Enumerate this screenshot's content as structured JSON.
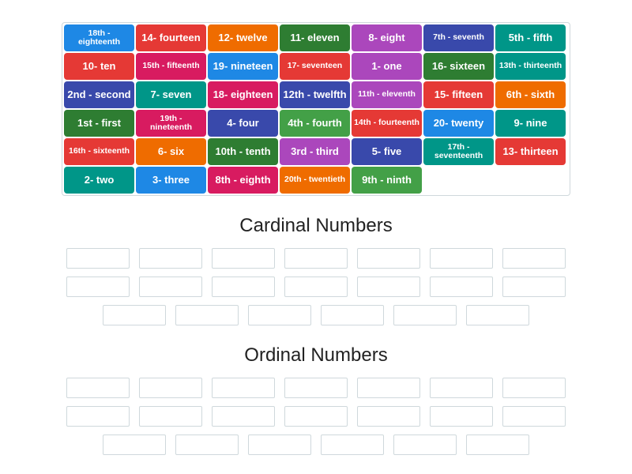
{
  "tiles": [
    {
      "label": "18th - eighteenth",
      "color": "c-blue",
      "small": true
    },
    {
      "label": "14- fourteen",
      "color": "c-red",
      "small": false
    },
    {
      "label": "12- twelve",
      "color": "c-orange",
      "small": false
    },
    {
      "label": "11- eleven",
      "color": "c-green",
      "small": false
    },
    {
      "label": "8- eight",
      "color": "c-purple",
      "small": false
    },
    {
      "label": "7th - seventh",
      "color": "c-indigo",
      "small": true
    },
    {
      "label": "5th - fifth",
      "color": "c-teal",
      "small": false
    },
    {
      "label": "10- ten",
      "color": "c-red",
      "small": false
    },
    {
      "label": "15th - fifteenth",
      "color": "c-magenta",
      "small": true
    },
    {
      "label": "19- nineteen",
      "color": "c-blue",
      "small": false
    },
    {
      "label": "17- seventeen",
      "color": "c-red",
      "small": true
    },
    {
      "label": "1- one",
      "color": "c-purple",
      "small": false
    },
    {
      "label": "16- sixteen",
      "color": "c-green",
      "small": false
    },
    {
      "label": "13th - thirteenth",
      "color": "c-teal",
      "small": true
    },
    {
      "label": "2nd - second",
      "color": "c-indigo",
      "small": false
    },
    {
      "label": "7- seven",
      "color": "c-teal",
      "small": false
    },
    {
      "label": "18- eighteen",
      "color": "c-magenta",
      "small": false
    },
    {
      "label": "12th - twelfth",
      "color": "c-indigo",
      "small": false
    },
    {
      "label": "11th - eleventh",
      "color": "c-purple",
      "small": true
    },
    {
      "label": "15- fifteen",
      "color": "c-red",
      "small": false
    },
    {
      "label": "6th - sixth",
      "color": "c-orange",
      "small": false
    },
    {
      "label": "1st - first",
      "color": "c-green",
      "small": false
    },
    {
      "label": "19th - nineteenth",
      "color": "c-magenta",
      "small": true
    },
    {
      "label": "4- four",
      "color": "c-indigo",
      "small": false
    },
    {
      "label": "4th - fourth",
      "color": "c-greenlt",
      "small": false
    },
    {
      "label": "14th - fourteenth",
      "color": "c-red",
      "small": true
    },
    {
      "label": "20- twenty",
      "color": "c-blue",
      "small": false
    },
    {
      "label": "9- nine",
      "color": "c-teal",
      "small": false
    },
    {
      "label": "16th - sixteenth",
      "color": "c-red",
      "small": true
    },
    {
      "label": "6- six",
      "color": "c-orange",
      "small": false
    },
    {
      "label": "10th - tenth",
      "color": "c-green",
      "small": false
    },
    {
      "label": "3rd - third",
      "color": "c-purple",
      "small": false
    },
    {
      "label": "5- five",
      "color": "c-indigo",
      "small": false
    },
    {
      "label": "17th - seventeenth",
      "color": "c-teal",
      "small": true
    },
    {
      "label": "13- thirteen",
      "color": "c-red",
      "small": false
    },
    {
      "label": "2- two",
      "color": "c-teal",
      "small": false
    },
    {
      "label": "3- three",
      "color": "c-blue",
      "small": false
    },
    {
      "label": "8th - eighth",
      "color": "c-magenta",
      "small": false
    },
    {
      "label": "20th - twentieth",
      "color": "c-orange",
      "small": true
    },
    {
      "label": "9th - ninth",
      "color": "c-greenlt",
      "small": false
    }
  ],
  "groups": [
    {
      "title": "Cardinal Numbers",
      "slots": 20
    },
    {
      "title": "Ordinal Numbers",
      "slots": 20
    }
  ]
}
